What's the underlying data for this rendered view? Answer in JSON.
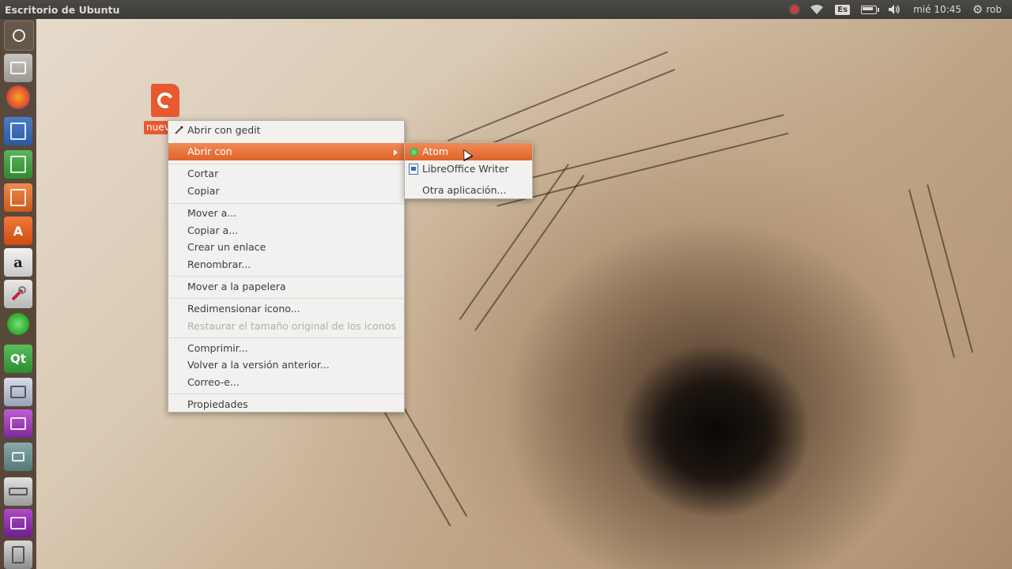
{
  "top_panel": {
    "title": "Escritorio de Ubuntu",
    "keyboard_layout": "Es",
    "clock": "mié 10:45",
    "user": "rob",
    "icons": [
      "record-indicator-icon",
      "wifi-icon",
      "keyboard-layout-icon",
      "battery-icon",
      "volume-icon",
      "session-gear-icon"
    ]
  },
  "launcher": {
    "items": [
      "ubuntu-dash",
      "files",
      "firefox",
      "libreoffice-writer",
      "libreoffice-calc",
      "libreoffice-impress",
      "ubuntu-software-center",
      "amazon",
      "system-settings",
      "green-app",
      "qt-creator",
      "remmina",
      "screen-recorder",
      "small-app",
      "drive",
      "purple-app",
      "trash"
    ],
    "amazon_glyph": "a",
    "software_glyph": "A",
    "qt_glyph": "Qt"
  },
  "desktop_file": {
    "label": "nuevo"
  },
  "context_menu": {
    "items": [
      {
        "label": "Abrir con gedit"
      },
      {
        "label": "Abrir con"
      },
      {
        "label": "Cortar"
      },
      {
        "label": "Copiar"
      },
      {
        "label": "Mover a..."
      },
      {
        "label": "Copiar a..."
      },
      {
        "label": "Crear un enlace"
      },
      {
        "label": "Renombrar..."
      },
      {
        "label": "Mover a la papelera"
      },
      {
        "label": "Redimensionar icono..."
      },
      {
        "label": "Restaurar el tamaño original de los iconos"
      },
      {
        "label": "Comprimir..."
      },
      {
        "label": "Volver a la versión anterior..."
      },
      {
        "label": "Correo-e..."
      },
      {
        "label": "Propiedades"
      }
    ]
  },
  "open_with_submenu": {
    "items": [
      {
        "label": "Atom"
      },
      {
        "label": "LibreOffice Writer"
      },
      {
        "label": "Otra aplicación..."
      }
    ]
  },
  "colors": {
    "highlight": "#e0642a",
    "panel": "#3c3b37",
    "menu_bg": "#f2f1f0",
    "file_icon": "#e65a2e"
  }
}
